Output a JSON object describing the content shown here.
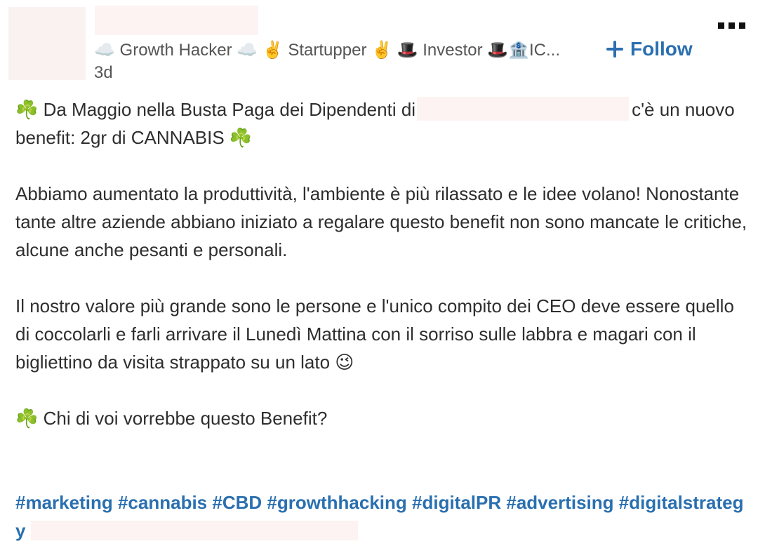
{
  "header": {
    "headline": "☁️ Growth Hacker ☁️ ✌️ Startupper ✌️ 🎩 Investor 🎩🏦IC...",
    "time": "3d",
    "follow_label": "Follow"
  },
  "post": {
    "line1_start": "☘️ Da Maggio nella Busta Paga dei Dipendenti di",
    "line1_end": "c'è un nuovo benefit: 2gr di CANNABIS ☘️",
    "para2": "Abbiamo aumentato la produttività, l'ambiente è più rilassato e le idee volano! Nonostante tante altre aziende abbiano iniziato a regalare questo benefit non sono mancate le critiche, alcune anche pesanti e personali.",
    "para3": "Il nostro valore più grande sono le persone e l'unico compito dei CEO deve essere quello di coccolarli e farli arrivare il Lunedì Mattina con il sorriso sulle labbra e magari con il bigliettino da visita strappato su un lato 😉",
    "para4": "☘️ Chi di voi vorrebbe questo Benefit?",
    "hashtags": [
      "#marketing",
      "#cannabis",
      "#CBD",
      "#growthhacking",
      "#digitalPR",
      "#advertising",
      "#digitalstrategy"
    ]
  }
}
